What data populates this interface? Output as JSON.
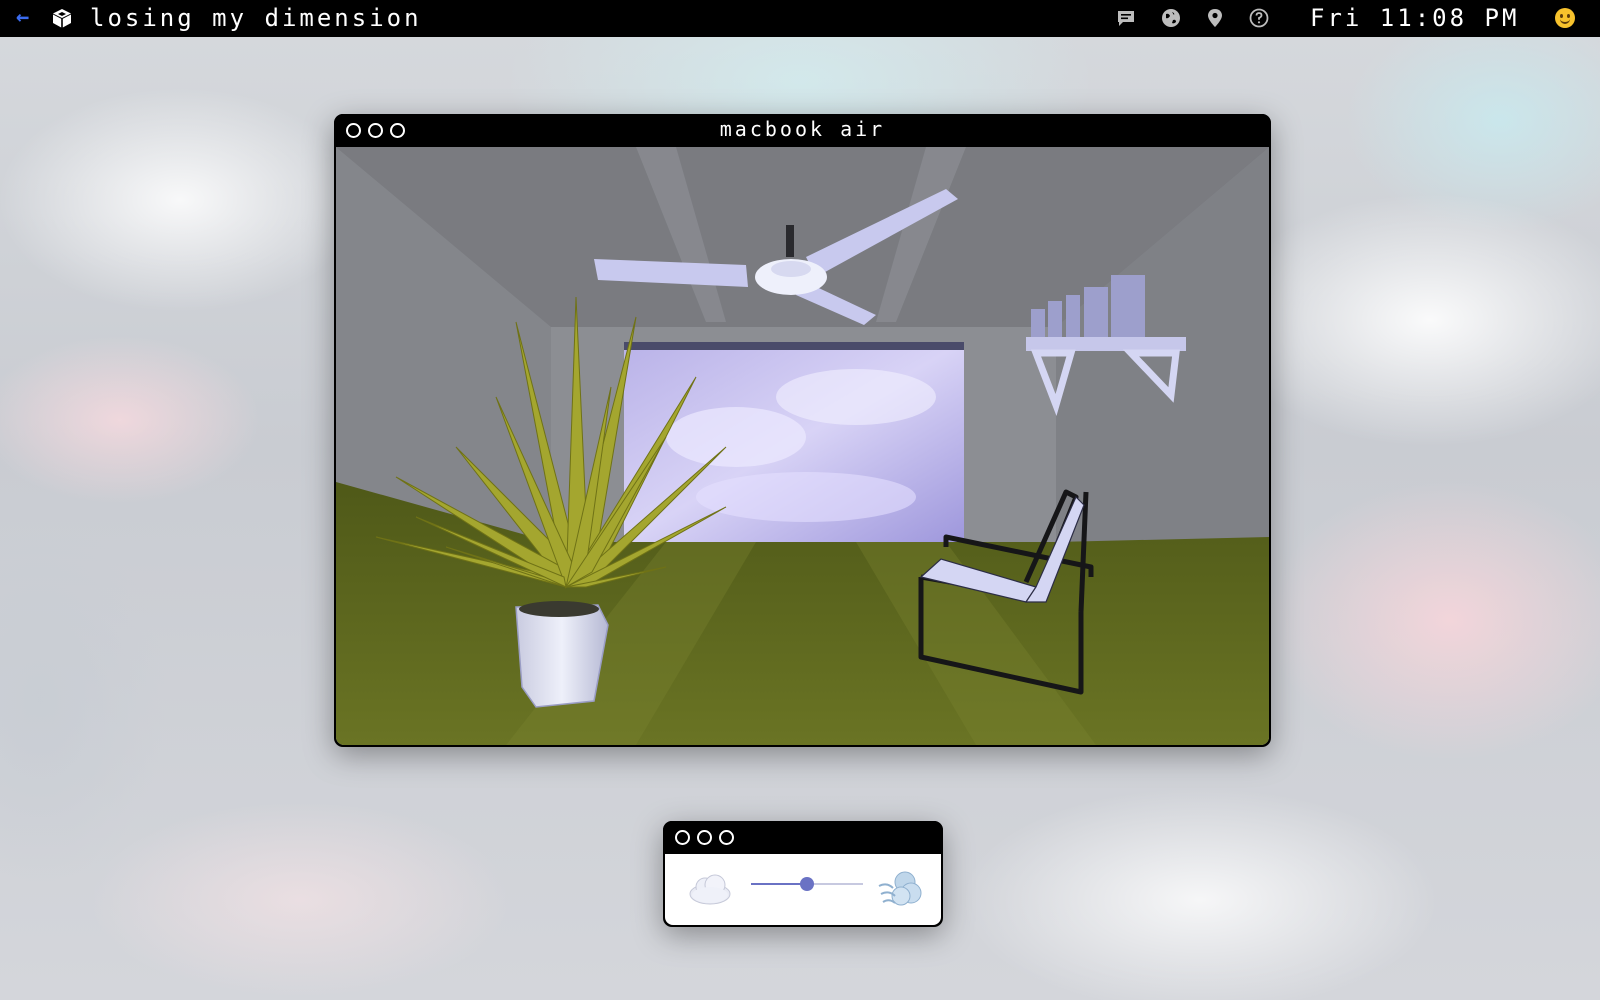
{
  "menubar": {
    "back_icon": "arrow-left-icon",
    "app_icon": "cube-icon",
    "title": "losing my dimension",
    "tray_icons": [
      "chat-icon",
      "globe-icon",
      "location-pin-icon",
      "help-icon"
    ],
    "clock": "Fri 11:08 PM",
    "user_icon": "smiley-emoji-icon"
  },
  "main_window": {
    "title": "macbook air"
  },
  "wind_widget": {
    "left_icon": "cloud-icon",
    "right_icon": "wind-gust-icon",
    "slider_value": 0.5,
    "accent_color": "#6a72c4"
  },
  "colors": {
    "menubar_bg": "#000000",
    "back_arrow": "#3b6cf0",
    "floor": "#5f6a1e",
    "plant": "#a3a52e"
  }
}
